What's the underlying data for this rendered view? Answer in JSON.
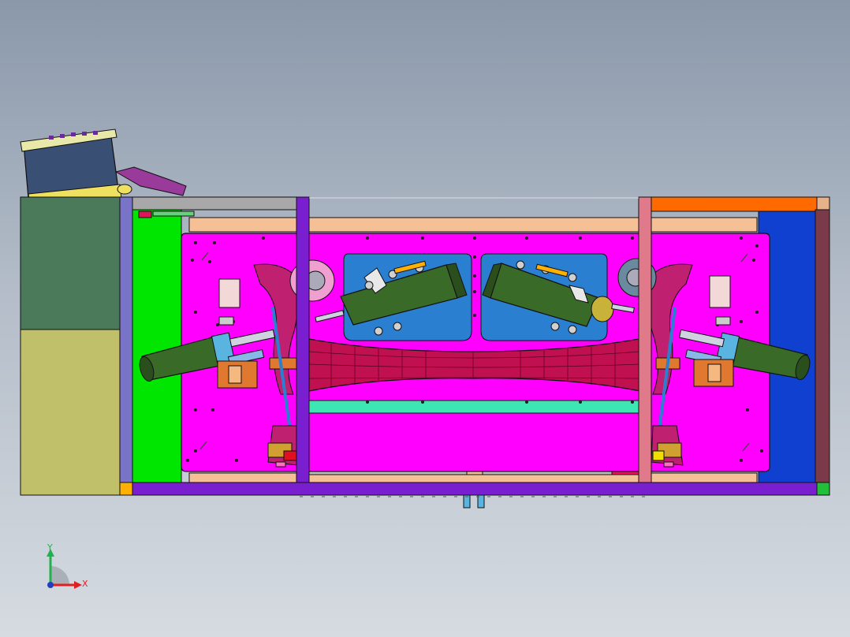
{
  "viewport": {
    "background_top": "#8a98aa",
    "background_bottom": "#d6dbe1"
  },
  "triad": {
    "x_label": "X",
    "y_label": "Y",
    "x_color": "#e02020",
    "y_color": "#22b24c",
    "origin_color": "#2040c0"
  },
  "colors": {
    "magenta_plate": "#ff00ff",
    "green_rail": "#00e600",
    "dark_green_panel": "#4a7a5a",
    "olive_panel": "#c0c06a",
    "blue_right": "#1040d0",
    "purple_frame": "#7a1fd0",
    "orange_top": "#ff6a00",
    "peach": "#f5c096",
    "teal_bar": "#3ee6b4",
    "crimson_tube": "#e0145a",
    "cylinder_green": "#3a6a28",
    "sky_pocket": "#2b7fd0",
    "gray_strip": "#a8a8a8"
  }
}
